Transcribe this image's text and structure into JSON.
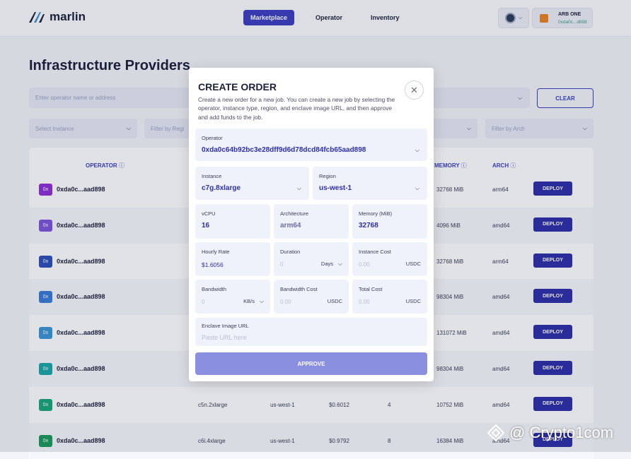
{
  "header": {
    "logo_text": "marlin",
    "nav": [
      "Marketplace",
      "Operator",
      "Inventory"
    ],
    "network": "ARB ONE",
    "wallet_address": "0xda0c...d898"
  },
  "page": {
    "title": "Infrastructure Providers",
    "search_placeholder": "Enter operator name or address",
    "clear_label": "CLEAR",
    "filter_instance": "Select Instance",
    "filter_region": "Filter by Regi",
    "filter_arch": "Filter by Arch"
  },
  "table": {
    "headers": {
      "operator": "OPERATOR",
      "memory": "MEMORY",
      "arch": "ARCH"
    },
    "deploy_label": "DEPLOY",
    "rows": [
      {
        "badge": "0x",
        "color": "#8e2fd6",
        "operator": "0xda0c...aad898",
        "instance": "",
        "region": "",
        "rate": "",
        "vcpu": "",
        "memory": "32768 MiB",
        "arch": "arm64"
      },
      {
        "badge": "0x",
        "color": "#7a55d9",
        "operator": "0xda0c...aad898",
        "instance": "",
        "region": "",
        "rate": "",
        "vcpu": "",
        "memory": "4096 MiB",
        "arch": "amd64"
      },
      {
        "badge": "0x",
        "color": "#2d4fb8",
        "operator": "0xda0c...aad898",
        "instance": "",
        "region": "",
        "rate": "",
        "vcpu": "",
        "memory": "32768 MiB",
        "arch": "arm64"
      },
      {
        "badge": "0x",
        "color": "#3a7bd5",
        "operator": "0xda0c...aad898",
        "instance": "",
        "region": "",
        "rate": "",
        "vcpu": "",
        "memory": "98304 MiB",
        "arch": "amd64"
      },
      {
        "badge": "0x",
        "color": "#3a95d6",
        "operator": "0xda0c...aad898",
        "instance": "",
        "region": "",
        "rate": "",
        "vcpu": "",
        "memory": "131072 MiB",
        "arch": "amd64"
      },
      {
        "badge": "0x",
        "color": "#1aa6a6",
        "operator": "0xda0c...aad898",
        "instance": "",
        "region": "",
        "rate": "",
        "vcpu": "",
        "memory": "98304 MiB",
        "arch": "amd64"
      },
      {
        "badge": "0x",
        "color": "#1aa67a",
        "operator": "0xda0c...aad898",
        "instance": "c5n.2xlarge",
        "region": "us-west-1",
        "rate": "$0.6012",
        "vcpu": "4",
        "memory": "10752 MiB",
        "arch": "amd64"
      },
      {
        "badge": "0x",
        "color": "#1a9a5a",
        "operator": "0xda0c...aad898",
        "instance": "c6i.4xlarge",
        "region": "us-west-1",
        "rate": "$0.9792",
        "vcpu": "8",
        "memory": "16384 MiB",
        "arch": "amd64"
      }
    ]
  },
  "modal": {
    "title": "CREATE ORDER",
    "description": "Create a new order for a new job. You can create a new job by selecting the operator, instance type, region, and enclave image URL, and then approve and add funds to the job.",
    "operator_label": "Operator",
    "operator_value": "0xda0c64b92bc3e28dff9d6d78dcd84fcb65aad898",
    "instance_label": "Instance",
    "instance_value": "c7g.8xlarge",
    "region_label": "Region",
    "region_value": "us-west-1",
    "vcpu_label": "vCPU",
    "vcpu_value": "16",
    "arch_label": "Architecture",
    "arch_value": "arm64",
    "memory_label": "Memory (MiB)",
    "memory_value": "32768",
    "hourly_label": "Hourly Rate",
    "hourly_value": "$1.6056",
    "duration_label": "Duration",
    "duration_placeholder": "0",
    "duration_unit": "Days",
    "instance_cost_label": "Instance Cost",
    "instance_cost_placeholder": "0.00",
    "instance_cost_unit": "USDC",
    "bandwidth_label": "Bandwidth",
    "bandwidth_placeholder": "0",
    "bandwidth_unit": "KB/s",
    "bandwidth_cost_label": "Bandwidth Cost",
    "bandwidth_cost_placeholder": "0.00",
    "bandwidth_cost_unit": "USDC",
    "total_cost_label": "Total Cost",
    "total_cost_placeholder": "0.00",
    "total_cost_unit": "USDC",
    "enclave_label": "Enclave Image URL",
    "enclave_placeholder": "Paste URL here",
    "approve_label": "APPROVE"
  },
  "watermark": "@ Crypto1com"
}
